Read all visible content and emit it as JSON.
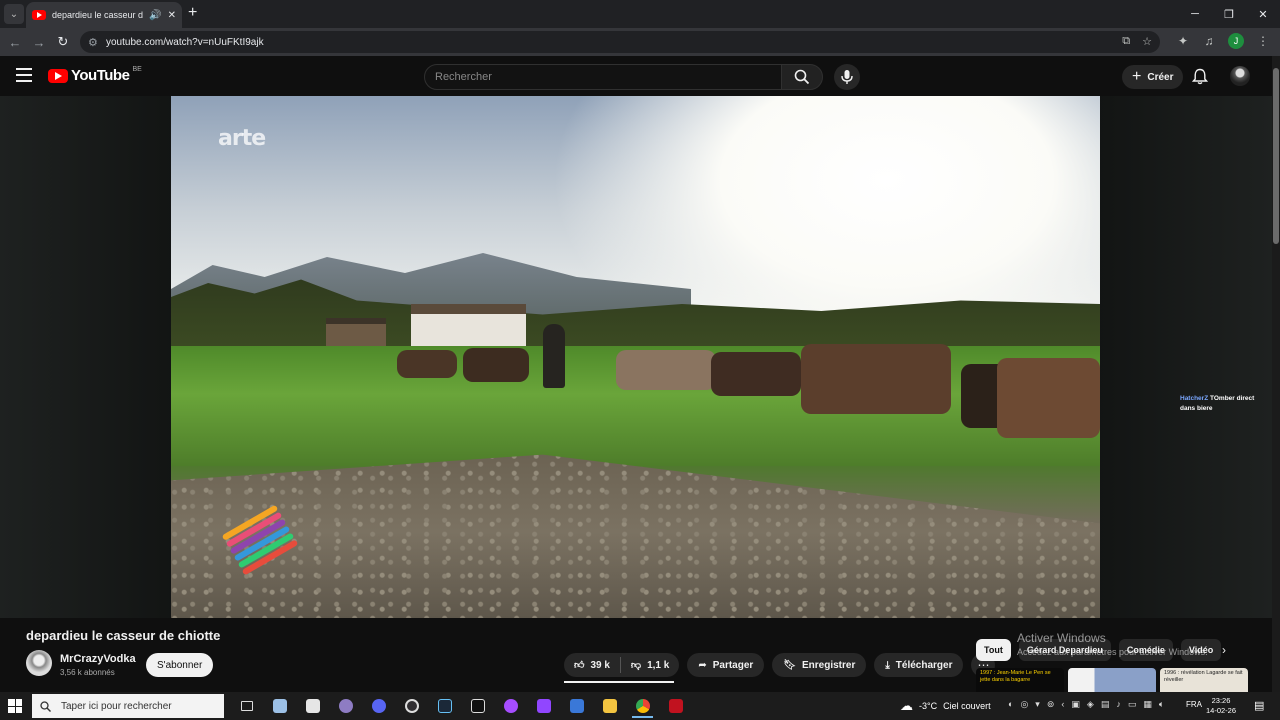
{
  "browser": {
    "tab_title": "depardieu le casseur de chi",
    "url": "youtube.com/watch?v=nUuFKtI9ajk",
    "profile_initial": "J"
  },
  "youtube": {
    "logo_text": "YouTube",
    "country": "BE",
    "search_placeholder": "Rechercher",
    "create_label": "Créer"
  },
  "video": {
    "watermark": "arte",
    "chat_user": "HatcherZ",
    "chat_message": "TOmber direct dans biere",
    "title": "depardieu le casseur de chiotte",
    "channel_name": "MrCrazyVodka",
    "subscribers": "3,56 k abonnés",
    "subscribe_label": "S'abonner",
    "likes": "39 k",
    "dislikes": "1,1 k",
    "share_label": "Partager",
    "save_label": "Enregistrer",
    "download_label": "Télécharger"
  },
  "chips": [
    "Tout",
    "Gérard Depardieu",
    "Comédie",
    "Vidéo"
  ],
  "watermark_windows": {
    "line1": "Activer Windows",
    "line2": "Accédez aux paramètres pour activer Windows."
  },
  "recommendations": [
    {
      "text": "1997 : Jean-Marie Le Pen se jette dans la bagarre",
      "bg": "#0a0a0a",
      "fg": "#ffd400"
    },
    {
      "text": "",
      "bg": "#8aa0c8",
      "fg": "#ffffff"
    },
    {
      "text": "1996 : révélation Lagarde se fait réveiller",
      "bg": "#e8e3d8",
      "fg": "#222222"
    }
  ],
  "taskbar": {
    "search_placeholder": "Taper ici pour rechercher",
    "temperature": "-3°C",
    "weather": "Ciel couvert",
    "language": "FRA",
    "time": "23:26",
    "date": "14-02-26"
  },
  "colors": {
    "brand_red": "#ff0000",
    "background": "#0f0f0f",
    "pill": "#272727"
  }
}
